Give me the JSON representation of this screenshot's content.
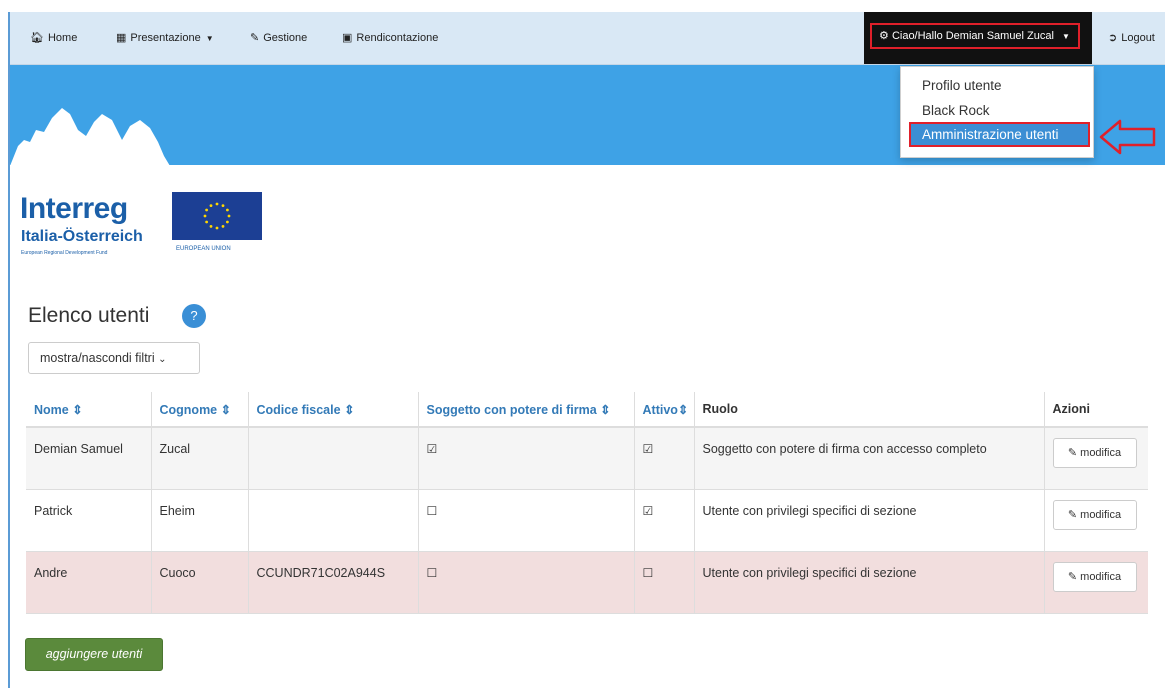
{
  "navbar": {
    "home": {
      "icon": "home-icon",
      "label": "Home"
    },
    "presentazione": {
      "icon": "document-icon",
      "label": "Presentazione"
    },
    "gestione": {
      "icon": "pencil-icon",
      "label": "Gestione"
    },
    "rendicontazione": {
      "icon": "card-icon",
      "label": "Rendicontazione"
    },
    "user_menu": {
      "icon": "gear-icon",
      "label": "Ciao/Hallo Demian Samuel Zucal"
    },
    "logout": {
      "icon": "logout-icon",
      "label": "Logout"
    }
  },
  "dropdown": {
    "items": [
      "Profilo utente",
      "Black Rock",
      "Amministrazione utenti"
    ]
  },
  "logo": {
    "title": "Interreg",
    "subtitle": "Italia-Österreich",
    "fund": "European Regional Development Fund",
    "eu": "EUROPEAN UNION"
  },
  "page": {
    "title": "Elenco utenti",
    "help": "?",
    "filter_toggle": "mostra/nascondi filtri",
    "add_button": "aggiungere utenti"
  },
  "table": {
    "headers": [
      "Nome",
      "Cognome",
      "Codice fiscale",
      "Soggetto con potere di firma",
      "Attivo",
      "Ruolo",
      "Azioni"
    ],
    "sort_icon": "⇕",
    "edit_label": "modifica",
    "rows": [
      {
        "nome": "Demian Samuel",
        "cognome": "Zucal",
        "codice": "",
        "firma": "checked",
        "attivo": "checked",
        "ruolo": "Soggetto con potere di firma con accesso completo"
      },
      {
        "nome": "Patrick",
        "cognome": "Eheim",
        "codice": "",
        "firma": "unchecked",
        "attivo": "checked",
        "ruolo": "Utente con privilegi specifici di sezione"
      },
      {
        "nome": "Andre",
        "cognome": "Cuoco",
        "codice": "CCUNDR71C02A944S",
        "firma": "unchecked",
        "attivo": "unchecked",
        "ruolo": "Utente con privilegi specifici di sezione"
      }
    ]
  },
  "colors": {
    "navbar": "#d9e8f5",
    "banner": "#3ea2e6",
    "highlight": "#e0202a",
    "link": "#337ab7",
    "danger_row": "#f2dede",
    "add_button": "#5b8a3c"
  }
}
